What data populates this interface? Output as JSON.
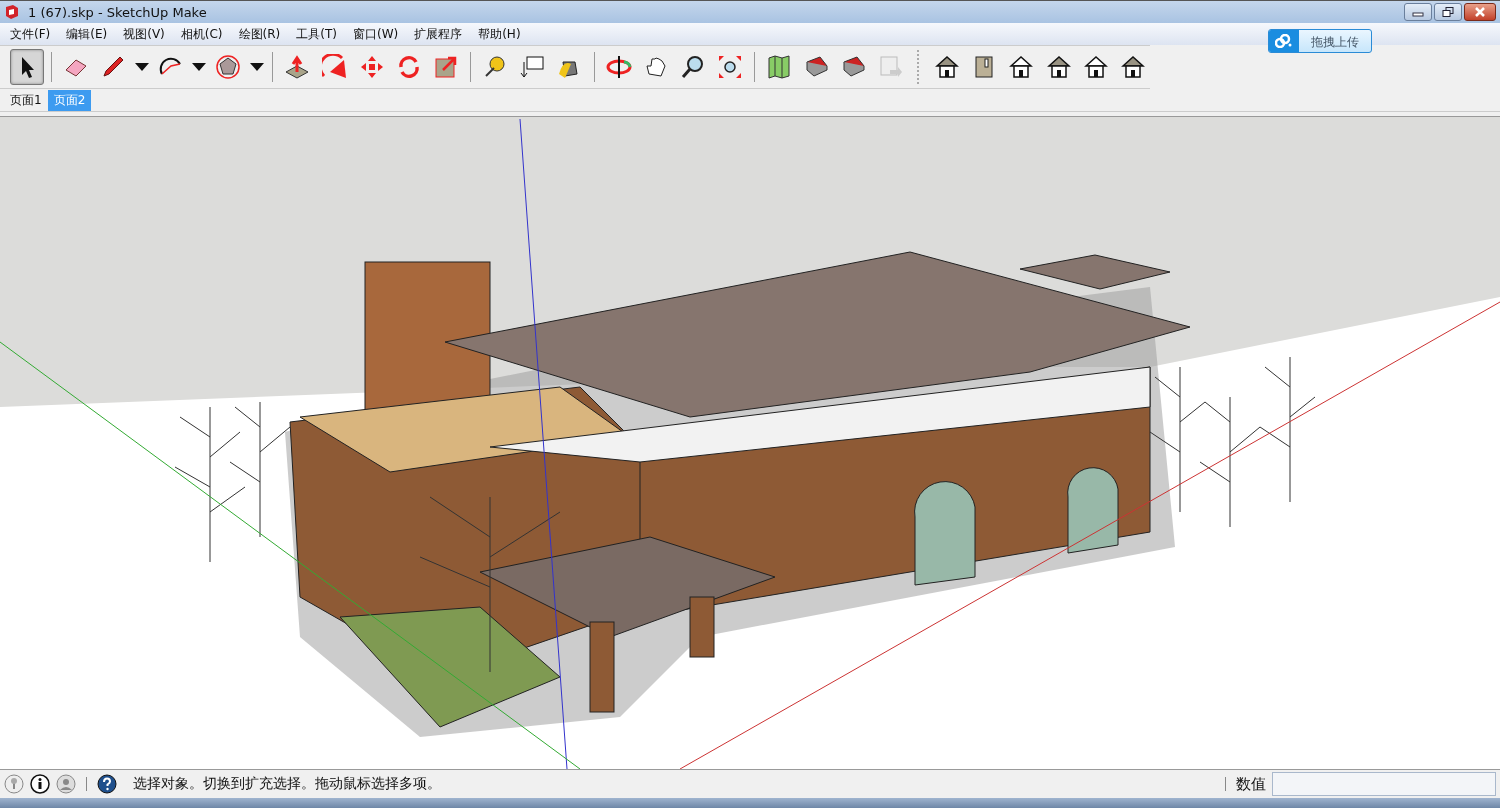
{
  "window": {
    "title": "1 (67).skp - SketchUp Make"
  },
  "menu": [
    "文件(F)",
    "编辑(E)",
    "视图(V)",
    "相机(C)",
    "绘图(R)",
    "工具(T)",
    "窗口(W)",
    "扩展程序",
    "帮助(H)"
  ],
  "upload_button": {
    "label": "拖拽上传"
  },
  "toolbar_groups": [
    [
      {
        "kind": "select",
        "selected": true
      }
    ],
    [
      {
        "kind": "eraser",
        "selected": false
      },
      {
        "kind": "pencil",
        "selected": false
      },
      {
        "kind": "dropdown",
        "selected": false
      },
      {
        "kind": "arc",
        "selected": false
      },
      {
        "kind": "dropdown",
        "selected": false
      },
      {
        "kind": "polygon",
        "selected": false
      },
      {
        "kind": "dropdown",
        "selected": false
      }
    ],
    [
      {
        "kind": "pushpull",
        "selected": false
      },
      {
        "kind": "followme",
        "selected": false
      },
      {
        "kind": "move",
        "selected": false
      },
      {
        "kind": "rotate",
        "selected": false
      },
      {
        "kind": "scale",
        "selected": false
      }
    ],
    [
      {
        "kind": "tape",
        "selected": false
      },
      {
        "kind": "text",
        "selected": false
      },
      {
        "kind": "paint",
        "selected": false
      }
    ],
    [
      {
        "kind": "orbit",
        "selected": false
      },
      {
        "kind": "pan",
        "selected": false
      },
      {
        "kind": "zoom",
        "selected": false
      },
      {
        "kind": "extents",
        "selected": false
      }
    ],
    [
      {
        "kind": "map",
        "selected": false
      },
      {
        "kind": "warehouse",
        "selected": false
      },
      {
        "kind": "share",
        "selected": false
      },
      {
        "kind": "export",
        "selected": false
      }
    ],
    [
      {
        "kind": "iso",
        "selected": false
      },
      {
        "kind": "top",
        "selected": false
      },
      {
        "kind": "front",
        "selected": false
      },
      {
        "kind": "right",
        "selected": false
      },
      {
        "kind": "back",
        "selected": false
      },
      {
        "kind": "left",
        "selected": false
      }
    ]
  ],
  "scene_tabs": [
    {
      "label": "页面1",
      "selected": false
    },
    {
      "label": "页面2",
      "selected": true
    }
  ],
  "status_bar": {
    "message": "选择对象。切换到扩充选择。拖动鼠标选择多项。",
    "measurements_label": "数值"
  }
}
